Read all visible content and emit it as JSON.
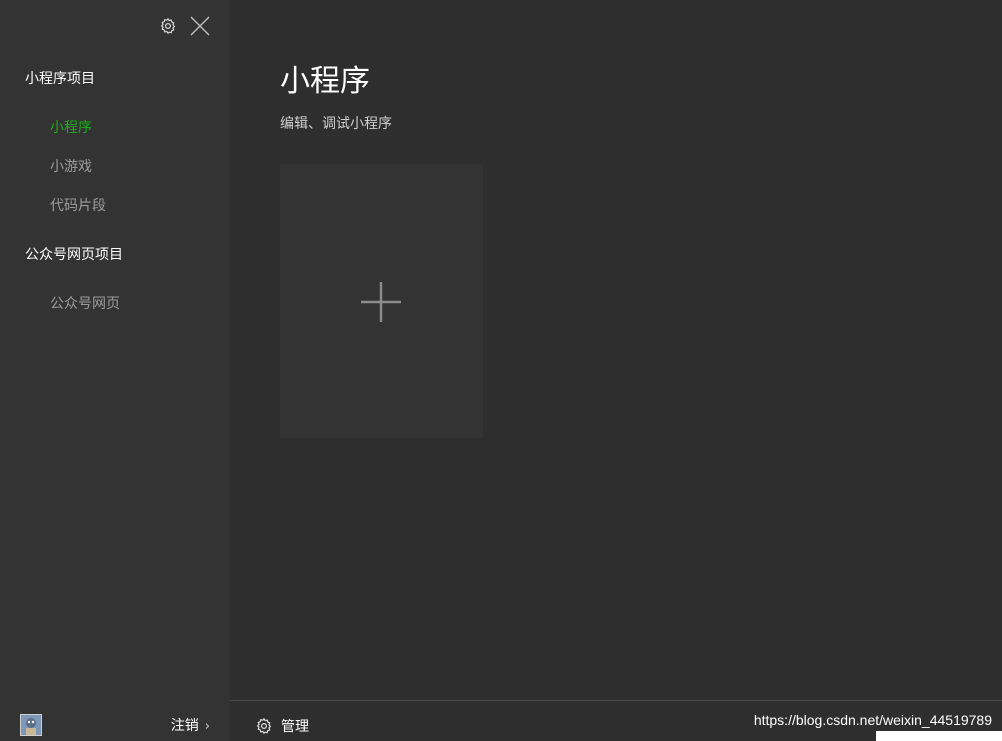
{
  "sidebar": {
    "sections": [
      {
        "title": "小程序项目",
        "items": [
          {
            "label": "小程序",
            "active": true
          },
          {
            "label": "小游戏",
            "active": false
          },
          {
            "label": "代码片段",
            "active": false
          }
        ]
      },
      {
        "title": "公众号网页项目",
        "items": [
          {
            "label": "公众号网页",
            "active": false
          }
        ]
      }
    ],
    "logout_label": "注销",
    "icons": {
      "settings": "gear-icon",
      "close": "close-icon",
      "logout_arrow": "chevron-right-icon"
    }
  },
  "main": {
    "title": "小程序",
    "subtitle": "编辑、调试小程序",
    "add_card_icon": "plus-icon"
  },
  "footer": {
    "manage_label": "管理",
    "manage_icon": "gear-icon",
    "watermark": "https://blog.csdn.net/weixin_44519789"
  },
  "colors": {
    "accent": "#1aad19",
    "sidebar_bg": "#333333",
    "main_bg": "#2e2e2e",
    "muted_text": "#9b9b9b"
  }
}
